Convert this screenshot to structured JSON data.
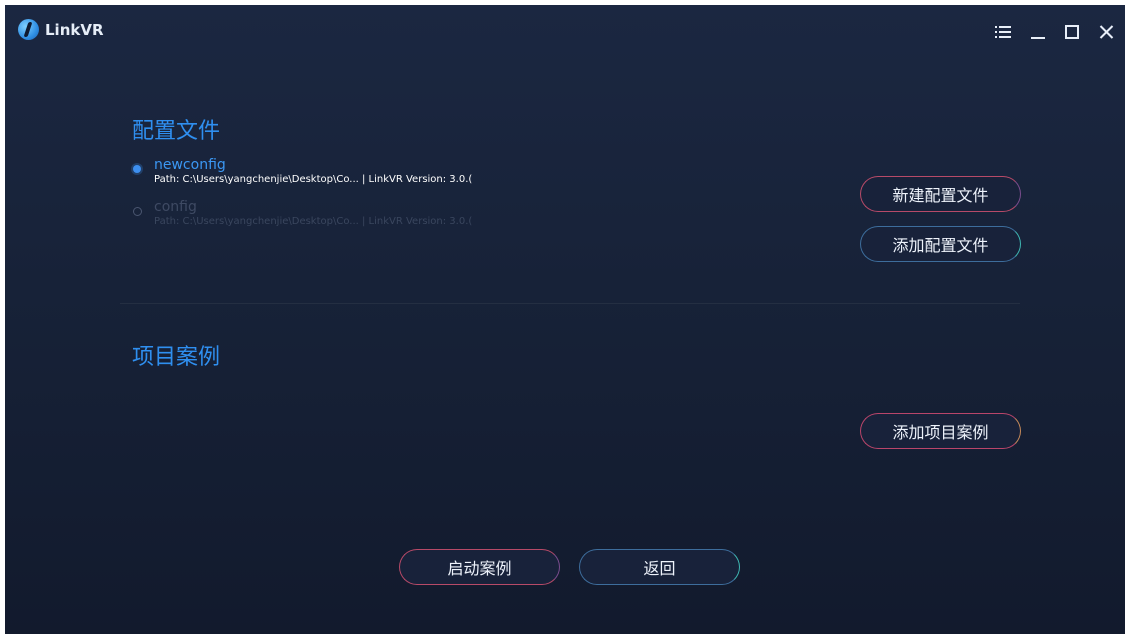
{
  "app": {
    "title": "LinkVR"
  },
  "title_controls": {
    "menu": "menu-icon",
    "minimize": "minimize-icon",
    "maximize": "maximize-icon",
    "close": "close-icon"
  },
  "config_section": {
    "title": "配置文件",
    "items": [
      {
        "name": "newconfig",
        "path": "Path: C:\\Users\\yangchenjie\\Desktop\\Co... | LinkVR Version: 3.0.(",
        "selected": true
      },
      {
        "name": "config",
        "path": "Path: C:\\Users\\yangchenjie\\Desktop\\Co... | LinkVR Version: 3.0.(",
        "selected": false
      }
    ],
    "new_button": "新建配置文件",
    "add_button": "添加配置文件"
  },
  "project_section": {
    "title": "项目案例",
    "add_button": "添加项目案例"
  },
  "footer": {
    "launch_button": "启动案例",
    "back_button": "返回"
  },
  "colors": {
    "accent": "#2f8ff0",
    "background": "#172238"
  }
}
